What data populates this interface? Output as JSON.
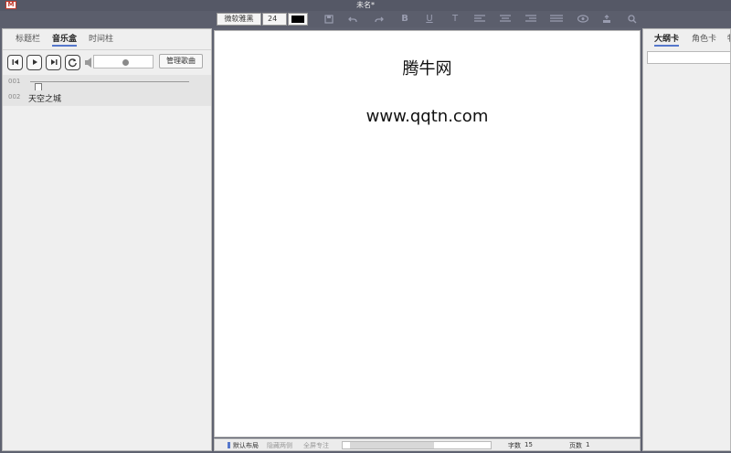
{
  "window": {
    "title": "未名*",
    "logo_letter": "M"
  },
  "toolbar": {
    "font_name": "微软雅黑",
    "font_size": "24",
    "font_color": "#000000",
    "icons": [
      "save-icon",
      "undo-icon",
      "redo-icon",
      "bold-icon",
      "underline-icon",
      "strikethrough-icon",
      "align-left-icon",
      "align-center-icon",
      "align-right-icon",
      "justify-icon",
      "preview-icon",
      "upload-icon",
      "search-icon"
    ],
    "bold_glyph": "B",
    "underline_glyph": "U",
    "strike_glyph": "T"
  },
  "left_panel": {
    "tabs": [
      {
        "label": "标题栏",
        "active": false
      },
      {
        "label": "音乐盒",
        "active": true
      },
      {
        "label": "时间柱",
        "active": false
      }
    ],
    "player": {
      "volume_percent": 55,
      "manage_songs_label": "管理歌曲"
    },
    "songs": [
      {
        "num": "001",
        "name": "",
        "progress_percent": 3
      },
      {
        "num": "002",
        "name": "天空之城"
      }
    ]
  },
  "editor": {
    "lines": [
      "腾牛网",
      "www.qqtn.com"
    ]
  },
  "status_bar": {
    "default_layout": "默认布局",
    "hide_sides": "隐藏两侧",
    "fullscreen": "全屏专注",
    "progress_percent": 60,
    "word_label": "字数",
    "word_count": "15",
    "page_label": "页数",
    "page_count": "1"
  },
  "right_panel": {
    "tabs": [
      {
        "label": "大纲卡",
        "active": true
      },
      {
        "label": "角色卡",
        "active": false
      },
      {
        "label": "物",
        "active": false
      }
    ],
    "search_value": ""
  },
  "colors": {
    "frame": "#5f6270",
    "accent": "#5577cc",
    "panel": "#efefef"
  }
}
